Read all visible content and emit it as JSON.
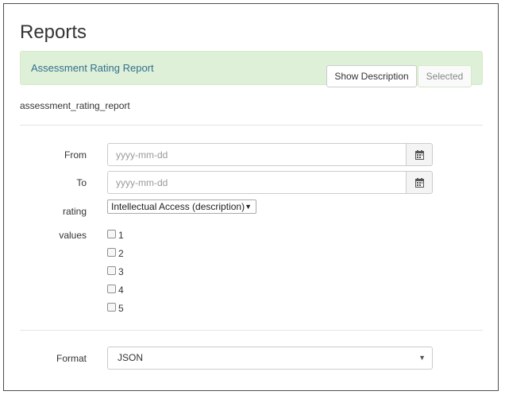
{
  "page": {
    "title": "Reports"
  },
  "banner": {
    "title": "Assessment Rating Report",
    "show_description_label": "Show Description",
    "selected_label": "Selected",
    "accent_color": "#dff0d8",
    "title_color": "#31708f"
  },
  "report": {
    "code": "assessment_rating_report"
  },
  "form": {
    "from": {
      "label": "From",
      "placeholder": "yyyy-mm-dd",
      "value": "",
      "icon": "calendar-icon"
    },
    "to": {
      "label": "To",
      "placeholder": "yyyy-mm-dd",
      "value": "",
      "icon": "calendar-icon"
    },
    "rating": {
      "label": "rating",
      "selected": "Intellectual Access (description)"
    },
    "values": {
      "label": "values",
      "options": [
        {
          "label": "1",
          "checked": false
        },
        {
          "label": "2",
          "checked": false
        },
        {
          "label": "3",
          "checked": false
        },
        {
          "label": "4",
          "checked": false
        },
        {
          "label": "5",
          "checked": false
        }
      ]
    },
    "format": {
      "label": "Format",
      "selected": "JSON"
    }
  }
}
